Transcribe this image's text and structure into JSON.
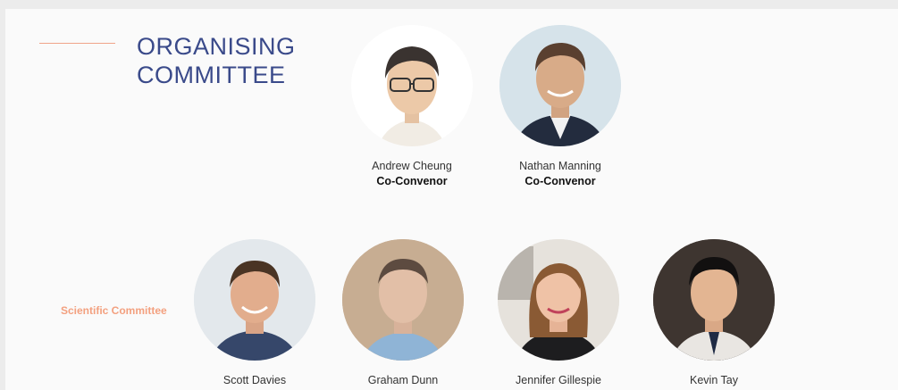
{
  "heading": {
    "line1": "ORGANISING",
    "line2": "COMMITTEE"
  },
  "section": {
    "scientific_label": "Scientific Committee"
  },
  "convenors": [
    {
      "name": "Andrew Cheung",
      "role": "Co-Convenor"
    },
    {
      "name": "Nathan Manning",
      "role": "Co-Convenor"
    }
  ],
  "scientific": [
    {
      "name": "Scott Davies"
    },
    {
      "name": "Graham Dunn"
    },
    {
      "name": "Jennifer Gillespie"
    },
    {
      "name": "Kevin Tay"
    }
  ],
  "colors": {
    "heading": "#3a4a8a",
    "accent": "#f3a07f",
    "panel_bg": "#fafafa"
  }
}
